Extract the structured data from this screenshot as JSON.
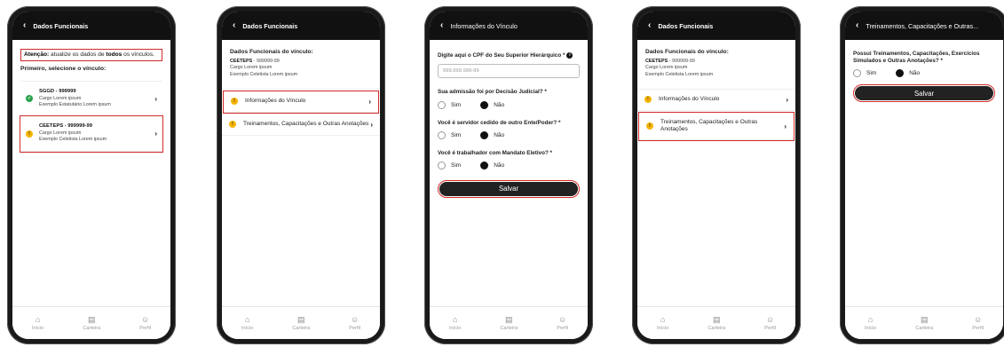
{
  "nav": {
    "home": "Início",
    "wallet": "Carteira",
    "profile": "Perfil"
  },
  "screen1": {
    "header": "Dados Funcionais",
    "alert_prefix": "Atenção:",
    "alert_mid": " atualize os dados de ",
    "alert_bold": "todos",
    "alert_suffix": " os vínculos.",
    "subtitle": "Primeiro, selecione o vínculo:",
    "vinculos": [
      {
        "name": "SGGD - 999999",
        "line1": "Cargo Lorem ipsum",
        "line2": "Exemplo Estatutário Lorem ipsum"
      },
      {
        "name": "CEETEPS - 999999-99",
        "line1": "Cargo Lorem ipsum",
        "line2": "Exemplo Celetista Lorem ipsum"
      }
    ]
  },
  "screen2": {
    "header": "Dados Funcionais",
    "title": "Dados Funcionais do vínculo:",
    "line_name": "CEETEPS",
    "line_code": " - 999999-99",
    "line2": "Cargo Lorem ipsum",
    "line3": "Exemplo Celetista Lorem ipsum",
    "item1": "Informações do Vínculo",
    "item2": "Treinamentos, Capacitações e Outras Anotações"
  },
  "screen3": {
    "header": "Informações do Vínculo",
    "q1": "Digite aqui o CPF do Seu Superior Hierárquico *",
    "q1_placeholder": "999.999.999-99",
    "q2": "Sua admissão foi por Decisão Judicial? *",
    "q3": "Você é servidor cedido de outro Ente/Poder? *",
    "q4": "Você é trabalhador com Mandato Eletivo? *",
    "yes": "Sim",
    "no": "Não",
    "save": "Salvar"
  },
  "screen4": {
    "header": "Dados Funcionais",
    "title": "Dados Funcionais do vínculo:",
    "line_name": "CEETEPS",
    "line_code": " - 999999-99",
    "line2": "Cargo Lorem ipsum",
    "line3": "Exemplo Celetista Lorem ipsum",
    "item1": "Informações do Vínculo",
    "item2": "Treinamentos, Capacitações e Outras Anotações"
  },
  "screen5": {
    "header": "Treinamentos, Capacitações e Outras...",
    "q1": "Possui Treinamentos, Capacitações, Exercícios Simulados e Outras Anotações? *",
    "yes": "Sim",
    "no": "Não",
    "save": "Salvar"
  },
  "icons": {
    "back": "chevron-left-icon",
    "next": "chevron-right-icon",
    "check": "check-icon",
    "warning": "exclamation-icon",
    "home": "home-icon",
    "wallet": "wallet-icon",
    "profile": "user-icon",
    "info": "info-icon"
  },
  "colors": {
    "highlight": "#d32a2a",
    "ok": "#2aa34a",
    "warning": "#f5b400",
    "header": "#111111"
  }
}
